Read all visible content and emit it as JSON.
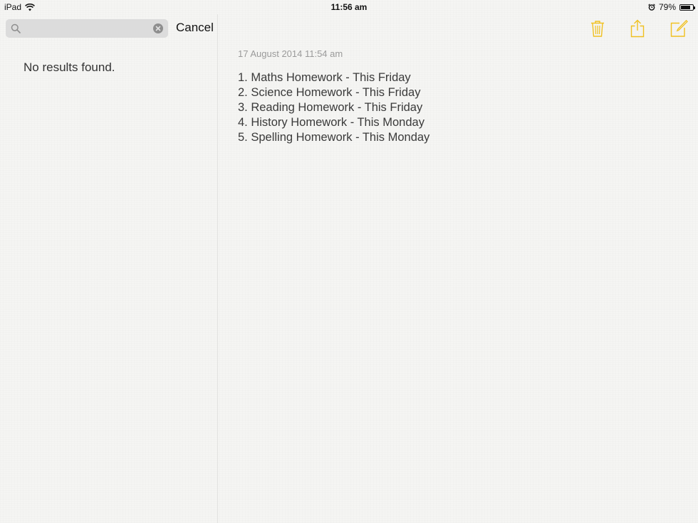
{
  "status_bar": {
    "device": "iPad",
    "time": "11:56 am",
    "battery": "79%",
    "battery_level": 0.79
  },
  "sidebar": {
    "search": {
      "value": "",
      "placeholder": ""
    },
    "cancel_label": "Cancel",
    "empty_message": "No results found."
  },
  "toolbar": {
    "icons": [
      "trash-icon",
      "share-icon",
      "compose-icon"
    ],
    "accent_color": "#f0c020"
  },
  "note": {
    "date": "17 August 2014 11:54 am",
    "lines": [
      "1. Maths Homework - This Friday",
      "2. Science Homework - This Friday",
      "3. Reading Homework - This Friday",
      "4. History Homework - This Monday",
      "5. Spelling Homework - This Monday"
    ]
  }
}
